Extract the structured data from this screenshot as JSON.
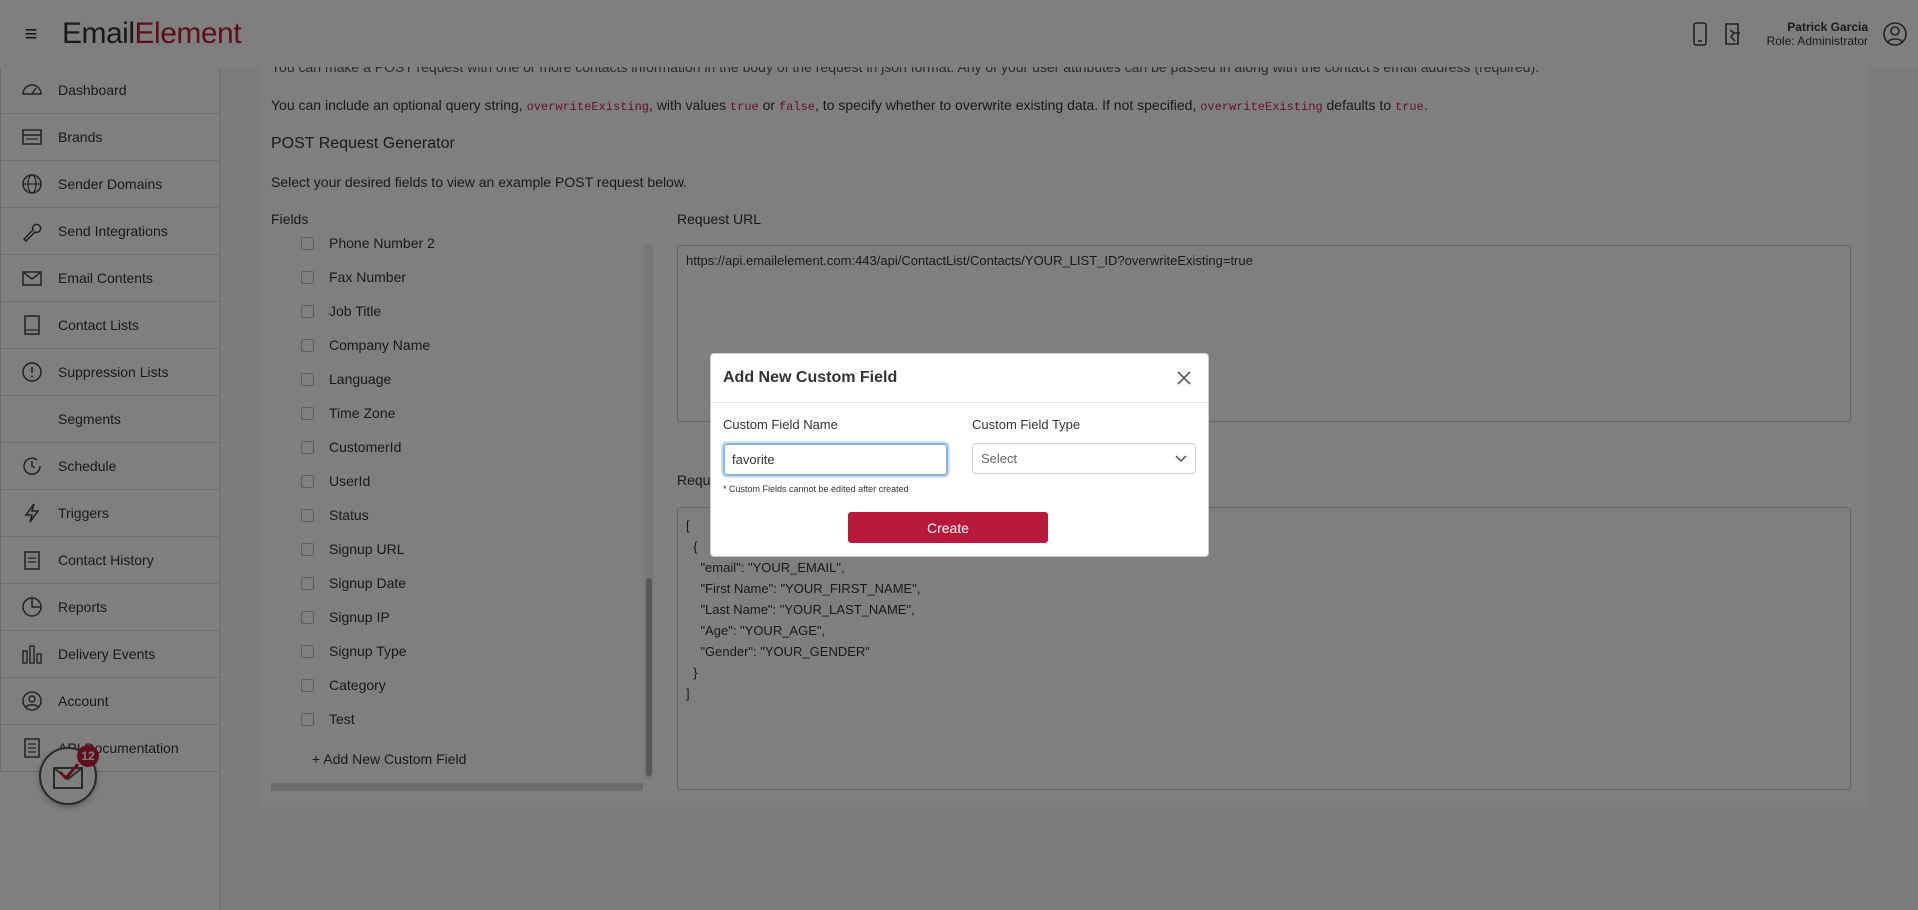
{
  "app": {
    "logo_part1": "Em",
    "logo_part2": "ail",
    "logo_part3": "Element",
    "brand_color": "#b81f3b"
  },
  "user": {
    "name": "Patrick Garcia",
    "role": "Role: Administrator"
  },
  "sidebar": {
    "items": [
      {
        "label": "Dashboard",
        "icon": "dashboard-icon"
      },
      {
        "label": "Brands",
        "icon": "brands-icon"
      },
      {
        "label": "Sender Domains",
        "icon": "globe-icon"
      },
      {
        "label": "Send Integrations",
        "icon": "wrench-icon"
      },
      {
        "label": "Email Contents",
        "icon": "envelope-icon"
      },
      {
        "label": "Contact Lists",
        "icon": "book-icon"
      },
      {
        "label": "Suppression Lists",
        "icon": "alert-icon"
      },
      {
        "label": "Segments",
        "icon": ""
      },
      {
        "label": "Schedule",
        "icon": "clock-icon"
      },
      {
        "label": "Triggers",
        "icon": "bolt-icon"
      },
      {
        "label": "Contact History",
        "icon": "clipboard-icon"
      },
      {
        "label": "Reports",
        "icon": "pie-icon"
      },
      {
        "label": "Delivery Events",
        "icon": "bars-icon"
      },
      {
        "label": "Account",
        "icon": "user-icon"
      },
      {
        "label": "API Documentation",
        "icon": "doc-icon"
      }
    ],
    "notification_count": "12"
  },
  "main": {
    "para1": "You can make a POST request with one or more contacts information in the body of the request in json format. Any of your user attributes can be passed in along with the contact's email address (required).",
    "para2_a": "You can include an optional query string, ",
    "para2_code1": "overwriteExisting",
    "para2_b": ", with values ",
    "para2_code2": "true",
    "para2_c": " or ",
    "para2_code3": "false",
    "para2_d": ", to specify whether to overwrite existing data. If not specified, ",
    "para2_code4": "overwriteExisting",
    "para2_e": " defaults to ",
    "para2_code5": "true",
    "para2_f": ".",
    "generator_title": "POST Request Generator",
    "generator_desc": "Select your desired fields to view an example POST request below.",
    "fields_label": "Fields",
    "request_url_label": "Request URL",
    "request_body_label": "Requ",
    "request_url": "https://api.emailelement.com:443/api/ContactList/Contacts/YOUR_LIST_ID?overwriteExisting=true",
    "request_body": "[\n  {\n    \"email\": \"YOUR_EMAIL\",\n    \"First Name\": \"YOUR_FIRST_NAME\",\n    \"Last Name\": \"YOUR_LAST_NAME\",\n    \"Age\": \"YOUR_AGE\",\n    \"Gender\": \"YOUR_GENDER\"\n  }\n]",
    "fields": [
      "Phone Number 2",
      "Fax Number",
      "Job Title",
      "Company Name",
      "Language",
      "Time Zone",
      "CustomerId",
      "UserId",
      "Status",
      "Signup URL",
      "Signup Date",
      "Signup IP",
      "Signup Type",
      "Category",
      "Test"
    ],
    "add_custom_field": "+ Add New Custom Field"
  },
  "modal": {
    "title": "Add New Custom Field",
    "name_label": "Custom Field Name",
    "name_value": "favorite",
    "type_label": "Custom Field Type",
    "type_value": "Select",
    "note": "* Custom Fields cannot be edited after created",
    "create_label": "Create"
  }
}
